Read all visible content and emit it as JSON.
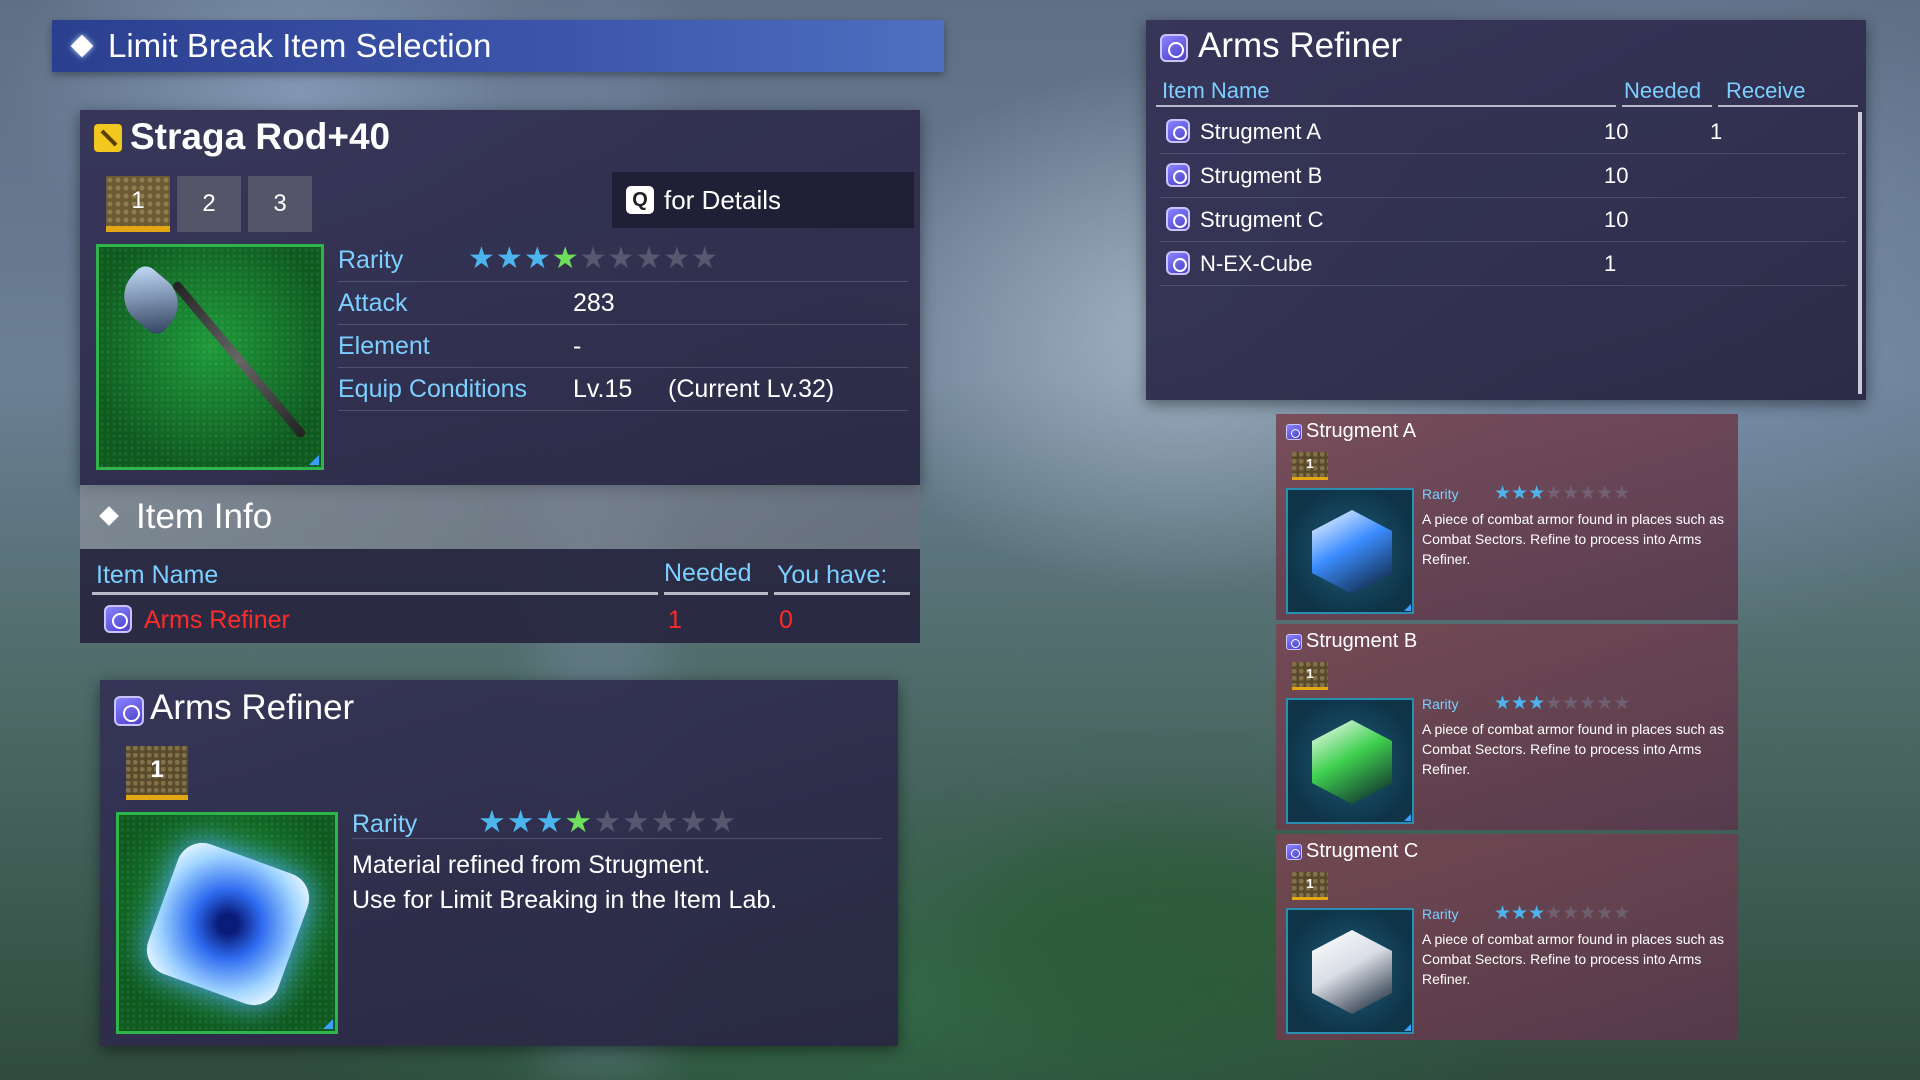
{
  "header": {
    "title": "Limit Break Item Selection"
  },
  "weapon": {
    "name": "Straga Rod+40",
    "tabs": [
      "1",
      "2",
      "3"
    ],
    "details_key": "Q",
    "details_label": "for Details",
    "rarity_label": "Rarity",
    "rarity_stars": 4,
    "rarity_max": 9,
    "stats": [
      {
        "label": "Attack",
        "value": "283",
        "extra": ""
      },
      {
        "label": "Element",
        "value": "-",
        "extra": ""
      },
      {
        "label": "Equip Conditions",
        "value": "Lv.15",
        "extra": "(Current Lv.32)"
      }
    ]
  },
  "item_info": {
    "title": "Item Info",
    "columns": {
      "name": "Item Name",
      "needed": "Needed",
      "have": "You have:"
    },
    "rows": [
      {
        "name": "Arms Refiner",
        "needed": "1",
        "have": "0"
      }
    ]
  },
  "refiner_detail": {
    "name": "Arms Refiner",
    "count": "1",
    "rarity_label": "Rarity",
    "rarity_stars": 4,
    "rarity_max": 9,
    "desc_line1": "Material refined from Strugment.",
    "desc_line2": "Use for Limit Breaking in the Item Lab."
  },
  "recipe": {
    "title": "Arms Refiner",
    "columns": {
      "name": "Item Name",
      "needed": "Needed",
      "receive": "Receive"
    },
    "rows": [
      {
        "name": "Strugment A",
        "needed": "10",
        "receive": "1"
      },
      {
        "name": "Strugment B",
        "needed": "10",
        "receive": ""
      },
      {
        "name": "Strugment C",
        "needed": "10",
        "receive": ""
      },
      {
        "name": "N-EX-Cube",
        "needed": "1",
        "receive": ""
      }
    ]
  },
  "cards": [
    {
      "name": "Strugment A",
      "count": "1",
      "rarity_label": "Rarity",
      "rarity_stars": 3,
      "rarity_max": 8,
      "desc": "A piece of combat armor found in places such as Combat Sectors. Refine to process into Arms Refiner.",
      "color": "#3b8cff"
    },
    {
      "name": "Strugment B",
      "count": "1",
      "rarity_label": "Rarity",
      "rarity_stars": 3,
      "rarity_max": 8,
      "desc": "A piece of combat armor found in places such as Combat Sectors. Refine to process into Arms Refiner.",
      "color": "#3fd04f"
    },
    {
      "name": "Strugment C",
      "count": "1",
      "rarity_label": "Rarity",
      "rarity_stars": 3,
      "rarity_max": 8,
      "desc": "A piece of combat armor found in places such as Combat Sectors. Refine to process into Arms Refiner.",
      "color": "#d9dde6"
    }
  ],
  "colors": {
    "accent": "#7ccfff",
    "warning": "#ff2a2a",
    "gold": "#e3a615",
    "star": "#4db5ee",
    "star_green": "#6ddf5c"
  }
}
